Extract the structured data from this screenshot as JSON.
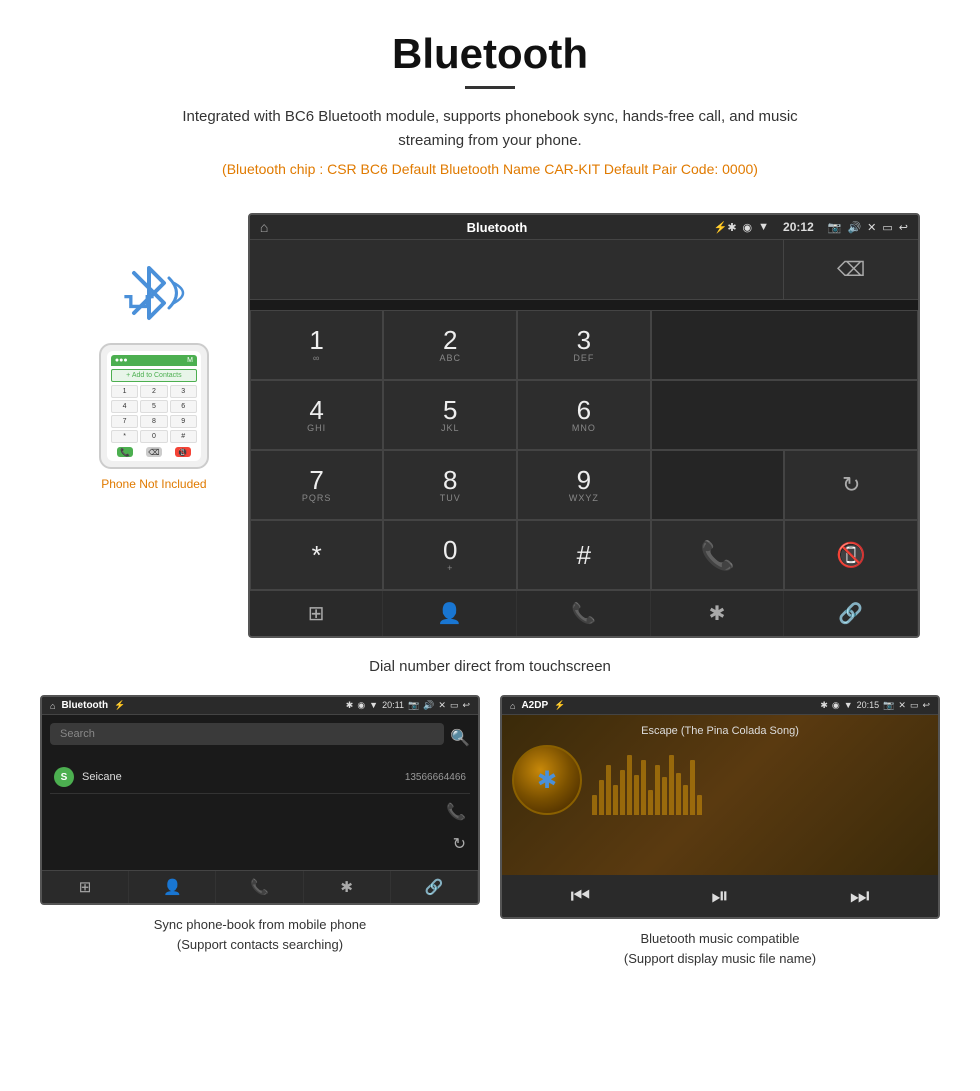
{
  "header": {
    "title": "Bluetooth",
    "description": "Integrated with BC6 Bluetooth module, supports phonebook sync, hands-free call, and music streaming from your phone.",
    "specs": "(Bluetooth chip : CSR BC6    Default Bluetooth Name CAR-KIT    Default Pair Code: 0000)"
  },
  "phone_note": "Phone Not Included",
  "main_screen": {
    "status_title": "Bluetooth",
    "time": "20:12",
    "dialpad": {
      "keys": [
        {
          "num": "1",
          "sub": ""
        },
        {
          "num": "2",
          "sub": "ABC"
        },
        {
          "num": "3",
          "sub": "DEF"
        },
        {
          "num": "4",
          "sub": "GHI"
        },
        {
          "num": "5",
          "sub": "JKL"
        },
        {
          "num": "6",
          "sub": "MNO"
        },
        {
          "num": "7",
          "sub": "PQRS"
        },
        {
          "num": "8",
          "sub": "TUV"
        },
        {
          "num": "9",
          "sub": "WXYZ"
        },
        {
          "num": "*",
          "sub": ""
        },
        {
          "num": "0",
          "sub": "+"
        },
        {
          "num": "#",
          "sub": ""
        }
      ]
    }
  },
  "main_caption": "Dial number direct from touchscreen",
  "phonebook_screen": {
    "status_title": "Bluetooth",
    "time": "20:11",
    "search_placeholder": "Search",
    "contact": {
      "letter": "S",
      "name": "Seicane",
      "number": "13566664466"
    }
  },
  "music_screen": {
    "status_title": "A2DP",
    "time": "20:15",
    "song_title": "Escape (The Pina Colada Song)"
  },
  "captions": {
    "phonebook": "Sync phone-book from mobile phone\n(Support contacts searching)",
    "music": "Bluetooth music compatible\n(Support display music file name)"
  },
  "nav_icons": {
    "grid": "⊞",
    "person": "👤",
    "phone": "📞",
    "bluetooth": "⚡",
    "link": "🔗",
    "home": "⌂",
    "back": "↩",
    "close": "✕",
    "window": "▭",
    "volume": "🔊",
    "camera": "📷"
  }
}
